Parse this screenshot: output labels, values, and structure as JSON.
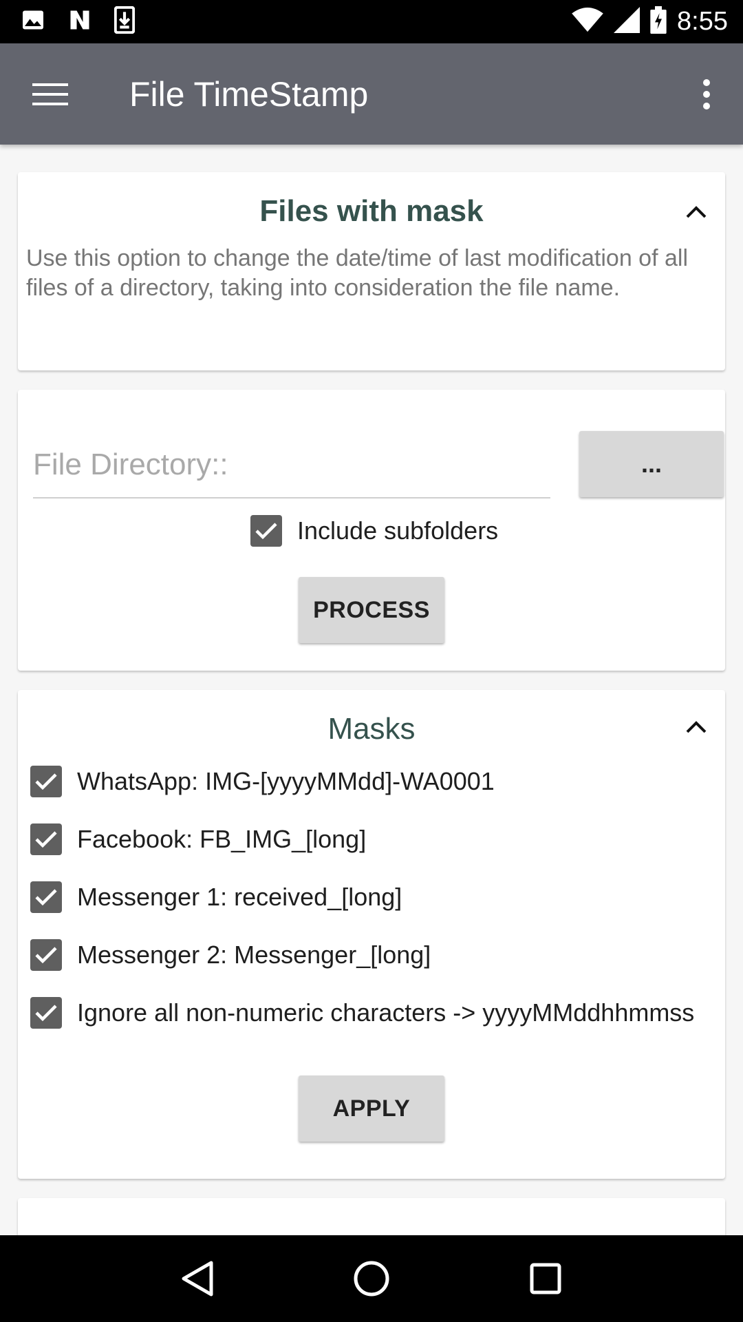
{
  "status_bar": {
    "time": "8:55",
    "icons": [
      "image-icon",
      "n-app-icon",
      "download-icon",
      "wifi-icon",
      "signal-icon",
      "battery-icon"
    ]
  },
  "app_bar": {
    "title": "File TimeStamp",
    "background_color": "#63656e"
  },
  "files_with_mask": {
    "title": "Files with mask",
    "description": "Use this option to change the date/time of last modification of all files of a directory, taking into consideration the file name."
  },
  "directory": {
    "input_value": "",
    "input_placeholder": "File Directory::",
    "browse_label": "...",
    "include_subfolders_label": "Include subfolders",
    "include_subfolders_checked": true,
    "process_label": "PROCESS"
  },
  "masks": {
    "title": "Masks",
    "items": [
      {
        "label": "WhatsApp: IMG-[yyyyMMdd]-WA0001",
        "checked": true
      },
      {
        "label": "Facebook: FB_IMG_[long]",
        "checked": true
      },
      {
        "label": "Messenger 1: received_[long]",
        "checked": true
      },
      {
        "label": "Messenger 2: Messenger_[long]",
        "checked": true
      },
      {
        "label": "Ignore all non-numeric characters -> yyyyMMddhhmmss",
        "checked": true
      }
    ],
    "apply_label": "APPLY"
  },
  "colors": {
    "title_text": "#35524d",
    "checkbox": "#5f5f5f",
    "button": "#d8d8d8"
  }
}
